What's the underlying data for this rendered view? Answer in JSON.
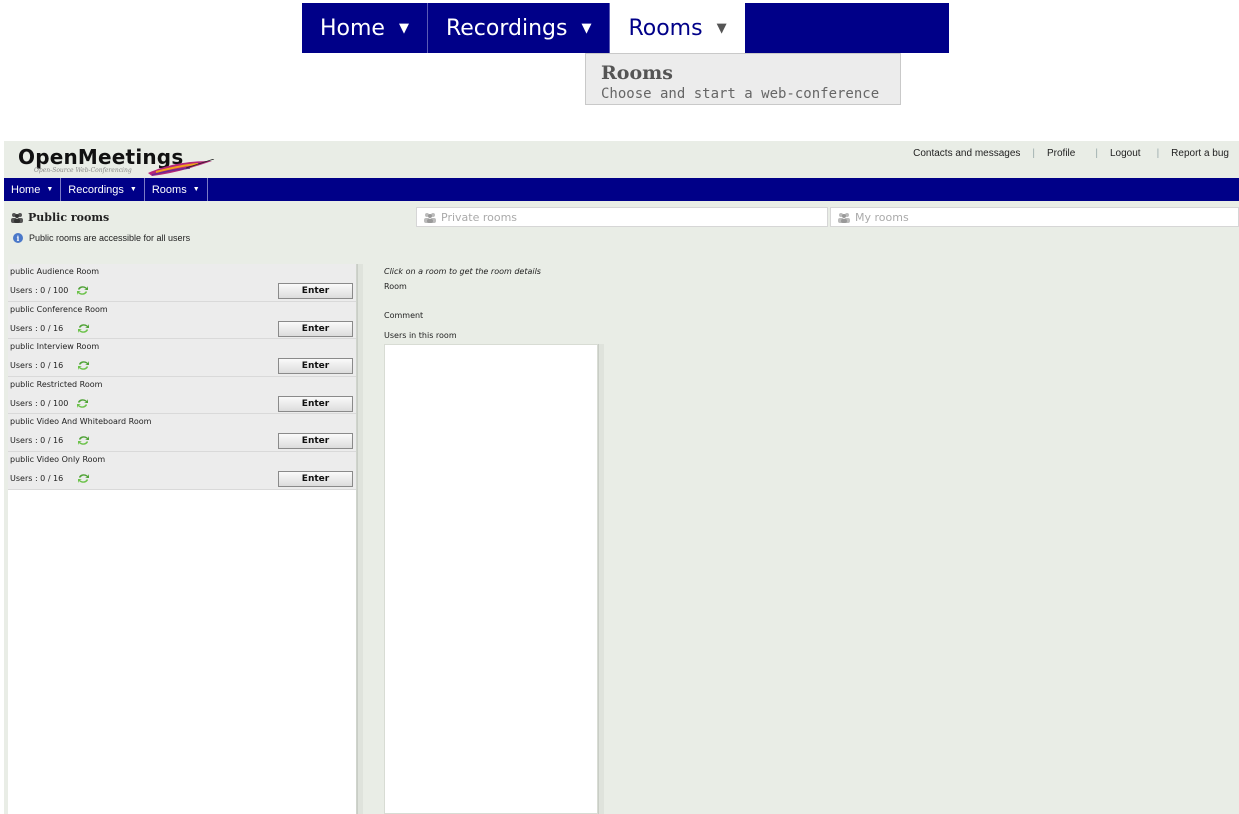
{
  "zoom": {
    "menu": [
      {
        "label": "Home"
      },
      {
        "label": "Recordings"
      },
      {
        "label": "Rooms"
      }
    ],
    "dropdown": {
      "title": "Rooms",
      "description": "Choose and start a web-conference"
    }
  },
  "app": {
    "logo": {
      "name": "OpenMeetings",
      "tagline": "Open-Source Web-Conferencing"
    },
    "top_links": [
      "Contacts and messages",
      "Profile",
      "Logout",
      "Report a bug"
    ],
    "nav": [
      {
        "label": "Home"
      },
      {
        "label": "Recordings"
      },
      {
        "label": "Rooms"
      }
    ],
    "tabs": [
      {
        "label": "Public rooms",
        "active": true
      },
      {
        "label": "Private rooms",
        "active": false
      },
      {
        "label": "My rooms",
        "active": false
      }
    ],
    "info_text": "Public rooms are accessible for all users",
    "rooms": [
      {
        "name": "public Audience Room",
        "users": "Users : 0 / 100",
        "enter": "Enter"
      },
      {
        "name": "public Conference Room",
        "users": "Users : 0 / 16",
        "enter": "Enter"
      },
      {
        "name": "public Interview Room",
        "users": "Users : 0 / 16",
        "enter": "Enter"
      },
      {
        "name": "public Restricted Room",
        "users": "Users : 0 / 100",
        "enter": "Enter"
      },
      {
        "name": "public Video And Whiteboard Room",
        "users": "Users : 0 / 16",
        "enter": "Enter"
      },
      {
        "name": "public Video Only Room",
        "users": "Users : 0 / 16",
        "enter": "Enter"
      }
    ],
    "details": {
      "hint": "Click on a room to get the room details",
      "room_label": "Room",
      "comment_label": "Comment",
      "users_label": "Users in this room"
    },
    "colors": {
      "nav_blue": "#000088",
      "app_bg": "#e9ede6"
    }
  }
}
